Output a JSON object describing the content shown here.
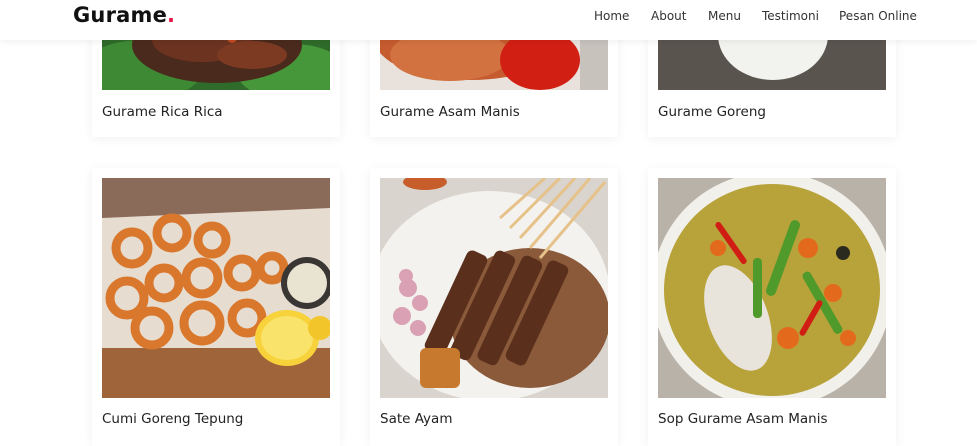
{
  "brand": {
    "name": "Gurame",
    "dot": "."
  },
  "nav": {
    "items": [
      {
        "label": "Home"
      },
      {
        "label": "About"
      },
      {
        "label": "Menu"
      },
      {
        "label": "Testimoni"
      },
      {
        "label": "Pesan Online"
      }
    ]
  },
  "menu": {
    "items": [
      {
        "title": "Gurame Rica Rica"
      },
      {
        "title": "Gurame Asam Manis"
      },
      {
        "title": "Gurame Goreng"
      },
      {
        "title": "Cumi Goreng Tepung"
      },
      {
        "title": "Sate Ayam"
      },
      {
        "title": "Sop Gurame Asam Manis"
      }
    ]
  },
  "colors": {
    "accent": "#e6184a",
    "text": "#222222"
  }
}
